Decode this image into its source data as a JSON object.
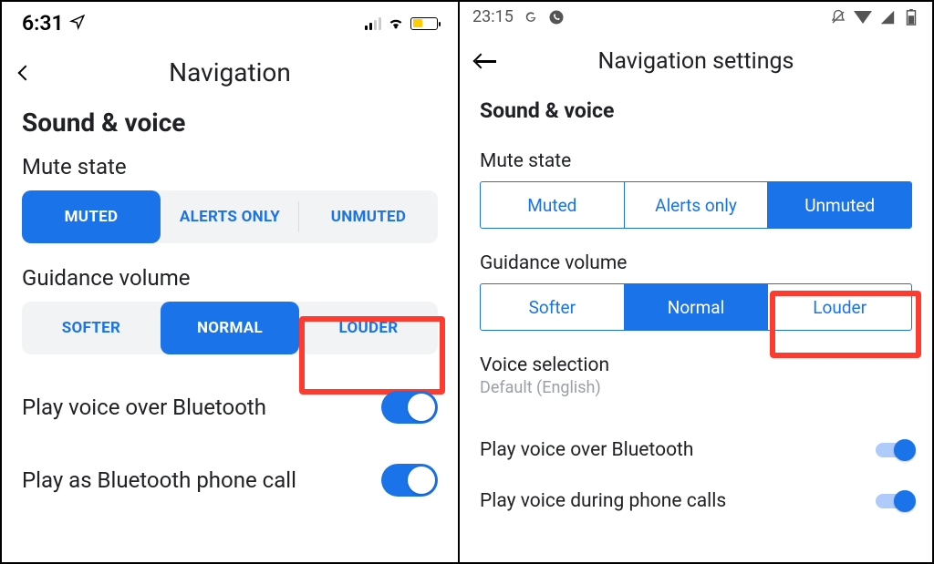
{
  "left": {
    "status": {
      "time": "6:31"
    },
    "header": {
      "title": "Navigation"
    },
    "section": "Sound & voice",
    "mute": {
      "label": "Mute state",
      "options": [
        "MUTED",
        "ALERTS ONLY",
        "UNMUTED"
      ],
      "active": 0
    },
    "guidance": {
      "label": "Guidance volume",
      "options": [
        "SOFTER",
        "NORMAL",
        "LOUDER"
      ],
      "active": 1
    },
    "toggles": [
      {
        "label": "Play voice over Bluetooth",
        "on": true
      },
      {
        "label": "Play as Bluetooth phone call",
        "on": true
      }
    ]
  },
  "right": {
    "status": {
      "time": "23:15"
    },
    "header": {
      "title": "Navigation settings"
    },
    "section": "Sound & voice",
    "mute": {
      "label": "Mute state",
      "options": [
        "Muted",
        "Alerts only",
        "Unmuted"
      ],
      "active": 2
    },
    "guidance": {
      "label": "Guidance volume",
      "options": [
        "Softer",
        "Normal",
        "Louder"
      ],
      "active": 1
    },
    "voice": {
      "title": "Voice selection",
      "value": "Default (English)"
    },
    "toggles": [
      {
        "label": "Play voice over Bluetooth",
        "on": true
      },
      {
        "label": "Play voice during phone calls",
        "on": true
      }
    ]
  }
}
